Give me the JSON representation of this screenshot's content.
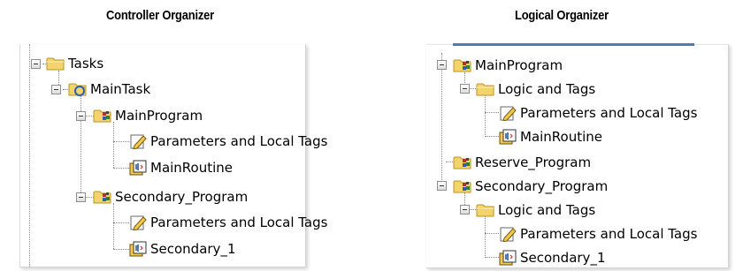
{
  "left": {
    "title": "Controller Organizer",
    "items": [
      {
        "label": "Tasks",
        "icon": "folder-icon"
      },
      {
        "label": "MainTask",
        "icon": "task-icon"
      },
      {
        "label": "MainProgram",
        "icon": "program-icon"
      },
      {
        "label": "Parameters and Local Tags",
        "icon": "tags-icon"
      },
      {
        "label": "MainRoutine",
        "icon": "routine-icon"
      },
      {
        "label": "Secondary_Program",
        "icon": "program-icon"
      },
      {
        "label": "Parameters and Local Tags",
        "icon": "tags-icon"
      },
      {
        "label": "Secondary_1",
        "icon": "routine-icon"
      }
    ]
  },
  "right": {
    "title": "Logical Organizer",
    "items": [
      {
        "label": "MainProgram",
        "icon": "program-icon"
      },
      {
        "label": "Logic and Tags",
        "icon": "folder-icon"
      },
      {
        "label": "Parameters and Local Tags",
        "icon": "tags-icon"
      },
      {
        "label": "MainRoutine",
        "icon": "routine-icon"
      },
      {
        "label": "Reserve_Program",
        "icon": "program-icon"
      },
      {
        "label": "Secondary_Program",
        "icon": "program-icon"
      },
      {
        "label": "Logic and Tags",
        "icon": "folder-icon"
      },
      {
        "label": "Parameters and Local Tags",
        "icon": "tags-icon"
      },
      {
        "label": "Secondary_1",
        "icon": "routine-icon"
      }
    ]
  },
  "colors": {
    "accent": "#4a7ab8",
    "folder": "#f2d46a",
    "program": "#3a8a3a"
  }
}
